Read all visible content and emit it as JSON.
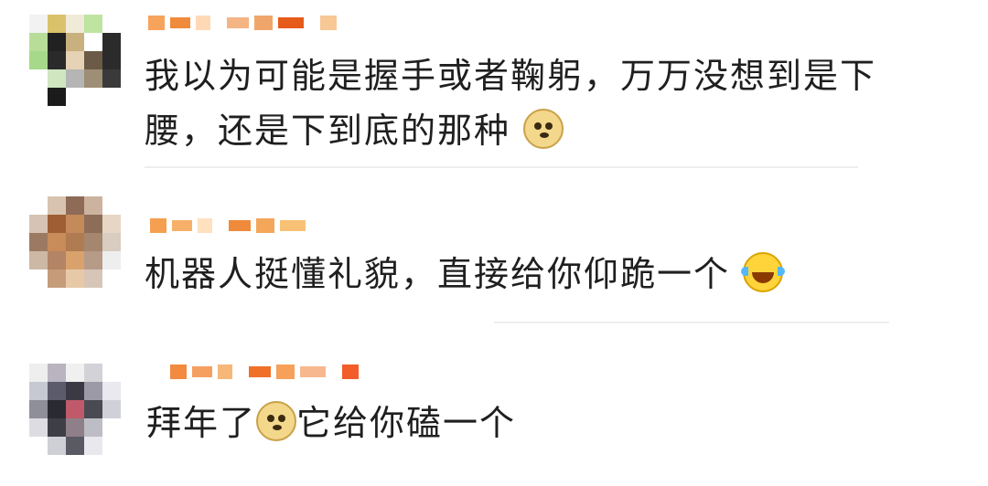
{
  "comments": [
    {
      "avatar_colors": [
        "#f2f2f2",
        "#d9c26a",
        "#f0ead8",
        "#bfe3a0",
        "#ffffff",
        "#b7dd99",
        "#212121",
        "#c9b07f",
        "#fff",
        "#2b2b2b",
        "#a6d98a",
        "#2a2a2a",
        "#e6d2b4",
        "#6b5a46",
        "#2b2b2b",
        "#fff",
        "#cfe6c0",
        "#b5b5b5",
        "#9e8e75",
        "#3a3a3a",
        "#fff",
        "#1b1b1b",
        "#fff",
        "#fff",
        "#fff"
      ],
      "name_blocks": [
        "#f7a35c",
        "#f08a3c",
        "#ffd9b6",
        "#f4b484",
        "#f0a66a",
        "#e65b1a",
        "#f7c894"
      ],
      "text_line1": "我以为可能是握手或者鞠躬，万万没想到是下",
      "text_line2": "腰，还是下到底的那种",
      "emoji": "doge-icon"
    },
    {
      "avatar_colors": [
        "#fff",
        "#d8c3b0",
        "#8e6b57",
        "#ccb3a0",
        "#fff",
        "#d7c3b4",
        "#a05e35",
        "#c48a5a",
        "#8d6d58",
        "#e7d6c6",
        "#9c7a62",
        "#c88b5a",
        "#b07b50",
        "#a5866f",
        "#d9ccc0",
        "#cdb7a5",
        "#b48466",
        "#d9a26c",
        "#b69b88",
        "#eee",
        "#fff",
        "#c59c7a",
        "#e7c9a8",
        "#d7c6b7",
        "#fff"
      ],
      "name_blocks": [
        "#f5a050",
        "#f7b06a",
        "#ffe0bf",
        "#f08a3c",
        "#f4a65a",
        "#f7c276"
      ],
      "text_line1": "机器人挺懂礼貌，直接给你仰跪一个",
      "emoji": "laughing-tears-icon"
    },
    {
      "avatar_colors": [
        "#eee",
        "#b9b4c0",
        "#f0f0f0",
        "#d2d2d8",
        "#fff",
        "#c6c8d2",
        "#5b5b6b",
        "#3b3a44",
        "#9b9aa6",
        "#e9e9ef",
        "#8f8f9a",
        "#2a2a32",
        "#c05a6a",
        "#4a4a52",
        "#d0d0d8",
        "#dcdce2",
        "#3e3e46",
        "#8f7f88",
        "#bdbdc6",
        "#fff",
        "#fff",
        "#cfcfd6",
        "#5a5a64",
        "#e8e8ee",
        "#fff"
      ],
      "name_blocks": [
        "#f28a40",
        "#f5a060",
        "#f7b779",
        "#f0702a",
        "#f6a05a",
        "#f7b890",
        "#f25d2a"
      ],
      "text_pre": "拜年了",
      "emoji": "doge-icon",
      "text_post": "它给你磕一个"
    }
  ]
}
